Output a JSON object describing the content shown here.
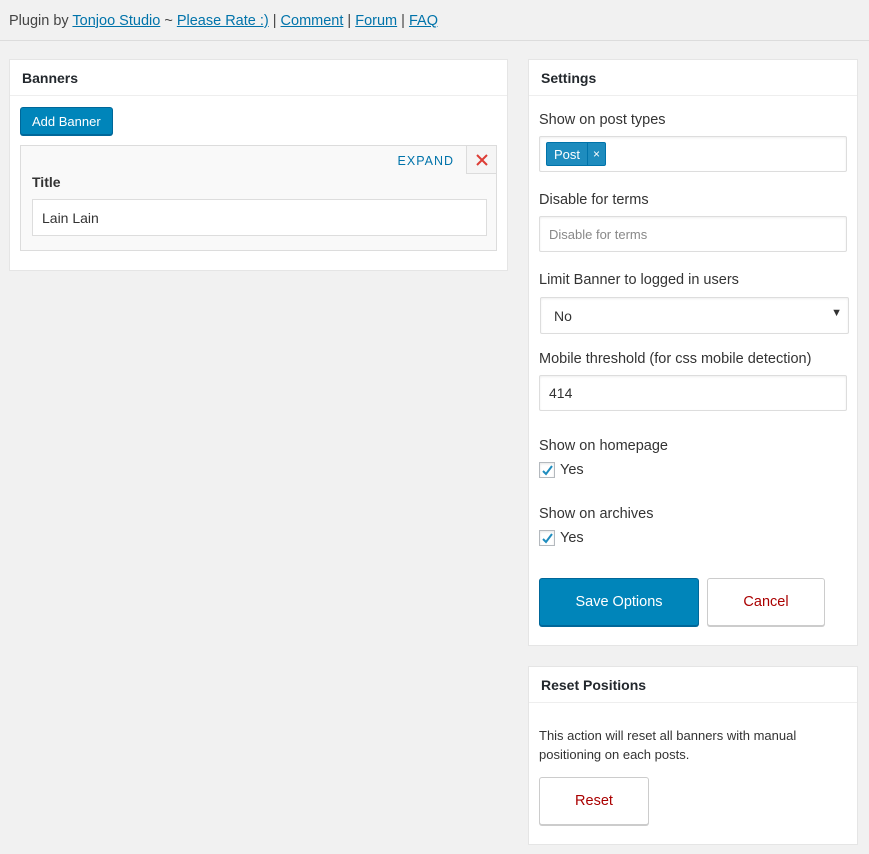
{
  "credits": {
    "prefix": "Plugin by ",
    "author_link": "Tonjoo Studio",
    "sep1": " ~ ",
    "rate_link": "Please Rate :)",
    "sep2": " | ",
    "comment_link": "Comment",
    "sep3": " | ",
    "forum_link": "Forum",
    "sep4": " | ",
    "faq_link": "FAQ"
  },
  "banners": {
    "title": "Banners",
    "add_label": "Add Banner",
    "item": {
      "expand_label": "EXPAND",
      "title_label": "Title",
      "title_value": "Lain Lain"
    }
  },
  "settings": {
    "title": "Settings",
    "post_types_label": "Show on post types",
    "post_types_tags": [
      "Post"
    ],
    "tag_remove": "×",
    "disable_terms_label": "Disable for terms",
    "disable_terms_placeholder": "Disable for terms",
    "limit_label": "Limit Banner to logged in users",
    "limit_value": "No",
    "select_arrow": "▼",
    "mobile_label": "Mobile threshold (for css mobile detection)",
    "mobile_value": "414",
    "homepage_label": "Show on homepage",
    "homepage_check_label": "Yes",
    "homepage_checked": true,
    "archives_label": "Show on archives",
    "archives_check_label": "Yes",
    "archives_checked": true,
    "save_label": "Save Options",
    "cancel_label": "Cancel"
  },
  "reset": {
    "title": "Reset Positions",
    "description": "This action will reset all banners with manual positioning on each posts.",
    "button_label": "Reset"
  },
  "colors": {
    "primary": "#0085ba",
    "link": "#0073aa",
    "danger": "#aa0000",
    "close": "#dd3d36"
  }
}
